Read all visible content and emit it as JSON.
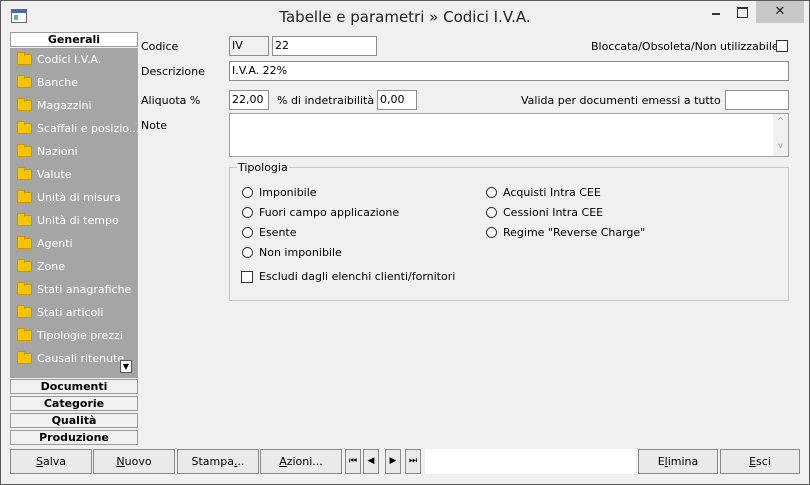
{
  "window": {
    "title": "Tabelle e parametri » Codici I.V.A.",
    "minimize": "–",
    "maximize": "□",
    "close": "✕"
  },
  "sidebar": {
    "sections": {
      "generali": "Generali",
      "documenti": "Documenti",
      "categorie": "Categorie",
      "qualita": "Qualità",
      "produzione": "Produzione"
    },
    "items": [
      "Codici I.V.A.",
      "Banche",
      "Magazzini",
      "Scaffali e posizio...",
      "Nazioni",
      "Valute",
      "Unità di misura",
      "Unità di tempo",
      "Agenti",
      "Zone",
      "Stati anagrafiche",
      "Stati articoli",
      "Tipologie prezzi",
      "Causali ritenute"
    ],
    "scroll_down": "▼"
  },
  "form": {
    "codice_label": "Codice",
    "codice_prefix": "IV",
    "codice_value": "22",
    "bloccata_label": "Bloccata/Obsoleta/Non utilizzabile",
    "descrizione_label": "Descrizione",
    "descrizione_value": "I.V.A. 22%",
    "aliquota_label": "Aliquota %",
    "aliquota_value": "22,00",
    "indetraibilita_label": "% di indetraibilità",
    "indetraibilita_value": "0,00",
    "valida_label": "Valida per documenti emessi a tutto il",
    "valida_value": "",
    "note_label": "Note",
    "note_value": "",
    "note_scroll_up": "^",
    "note_scroll_down": "v"
  },
  "tipologia": {
    "title": "Tipologia",
    "left_options": [
      "Imponibile",
      "Fuori campo applicazione",
      "Esente",
      "Non imponibile"
    ],
    "right_options": [
      "Acquisti Intra CEE",
      "Cessioni Intra CEE",
      "Regime \"Reverse Charge\""
    ],
    "escludi_label": "Escludi dagli elenchi clienti/fornitori"
  },
  "toolbar": {
    "salva": {
      "u": "S",
      "rest": "alva"
    },
    "nuovo": {
      "u": "N",
      "rest": "uovo"
    },
    "stampa": {
      "pre": "Stampa",
      "u": ".",
      "rest": ".."
    },
    "azioni": {
      "u": "A",
      "rest": "zioni..."
    },
    "nav_first": "⏮",
    "nav_prev": "◀",
    "nav_next": "▶",
    "nav_last": "⏭",
    "elimina": {
      "pre": "E",
      "u": "l",
      "rest": "imina"
    },
    "esci": {
      "u": "E",
      "rest": "sci"
    }
  }
}
